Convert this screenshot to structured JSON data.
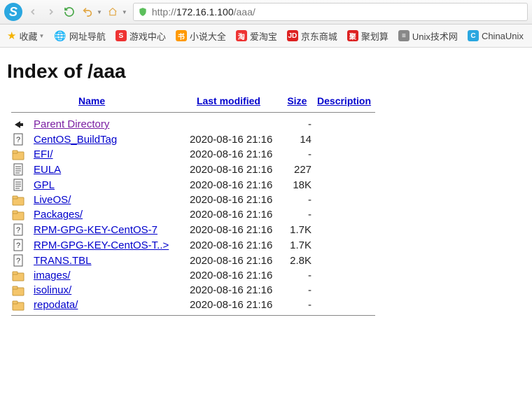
{
  "browser": {
    "url_http": "http://",
    "url_host": "172.16.1.100",
    "url_path": "/aaa/"
  },
  "bookmarks": {
    "fav_label": "收藏",
    "items": [
      {
        "label": "网址导航",
        "icon": "globe"
      },
      {
        "label": "游戏中心",
        "icon": "red-s"
      },
      {
        "label": "小说大全",
        "icon": "orange-q"
      },
      {
        "label": "爱淘宝",
        "icon": "red-tao"
      },
      {
        "label": "京东商城",
        "icon": "red-jd"
      },
      {
        "label": "聚划算",
        "icon": "red-ju"
      },
      {
        "label": "Unix技术网",
        "icon": "doc"
      },
      {
        "label": "ChinaUnix",
        "icon": "blue-c"
      }
    ]
  },
  "page": {
    "heading": "Index of /aaa",
    "columns": {
      "name": "Name",
      "last_modified": "Last modified",
      "size": "Size",
      "description": "Description"
    },
    "rows": [
      {
        "icon": "back",
        "name": "Parent Directory",
        "date": "",
        "size": "-",
        "visited": true
      },
      {
        "icon": "unknown",
        "name": "CentOS_BuildTag",
        "date": "2020-08-16 21:16",
        "size": "14"
      },
      {
        "icon": "folder",
        "name": "EFI/",
        "date": "2020-08-16 21:16",
        "size": "-"
      },
      {
        "icon": "text",
        "name": "EULA",
        "date": "2020-08-16 21:16",
        "size": "227"
      },
      {
        "icon": "text",
        "name": "GPL",
        "date": "2020-08-16 21:16",
        "size": "18K"
      },
      {
        "icon": "folder",
        "name": "LiveOS/",
        "date": "2020-08-16 21:16",
        "size": "-"
      },
      {
        "icon": "folder",
        "name": "Packages/",
        "date": "2020-08-16 21:16",
        "size": "-"
      },
      {
        "icon": "unknown",
        "name": "RPM-GPG-KEY-CentOS-7",
        "date": "2020-08-16 21:16",
        "size": "1.7K"
      },
      {
        "icon": "unknown",
        "name": "RPM-GPG-KEY-CentOS-T..>",
        "date": "2020-08-16 21:16",
        "size": "1.7K"
      },
      {
        "icon": "unknown",
        "name": "TRANS.TBL",
        "date": "2020-08-16 21:16",
        "size": "2.8K"
      },
      {
        "icon": "folder",
        "name": "images/",
        "date": "2020-08-16 21:16",
        "size": "-"
      },
      {
        "icon": "folder",
        "name": "isolinux/",
        "date": "2020-08-16 21:16",
        "size": "-"
      },
      {
        "icon": "folder",
        "name": "repodata/",
        "date": "2020-08-16 21:16",
        "size": "-"
      }
    ]
  }
}
